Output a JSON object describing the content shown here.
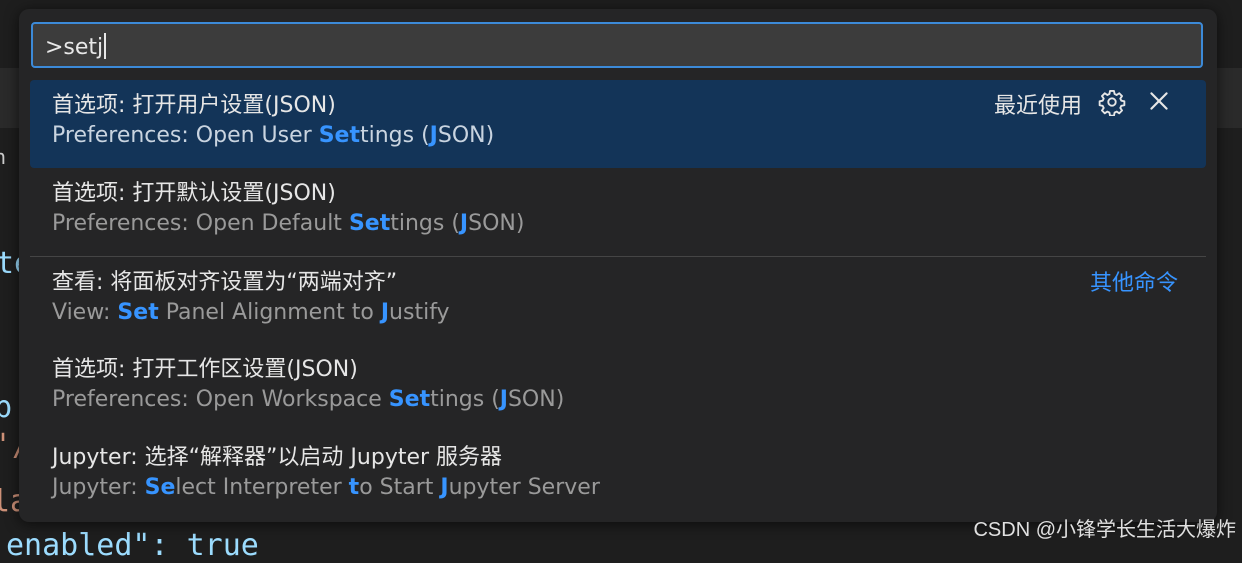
{
  "editor_fragments": [
    "n",
    "te",
    "b",
    "'/",
    "la",
    "enabled\": true"
  ],
  "palette": {
    "input_value": ">setj",
    "items": [
      {
        "label": "首选项: 打开用户设置(JSON)",
        "detail_parts": [
          {
            "t": "Preferences: Open User ",
            "h": false
          },
          {
            "t": "Set",
            "h": true
          },
          {
            "t": "tings (",
            "h": false
          },
          {
            "t": "J",
            "h": true
          },
          {
            "t": "SON)",
            "h": false
          }
        ],
        "selected": true,
        "recently_used": "最近使用"
      },
      {
        "label": "首选项: 打开默认设置(JSON)",
        "detail_parts": [
          {
            "t": "Preferences: Open Default ",
            "h": false
          },
          {
            "t": "Set",
            "h": true
          },
          {
            "t": "tings (",
            "h": false
          },
          {
            "t": "J",
            "h": true
          },
          {
            "t": "SON)",
            "h": false
          }
        ]
      },
      {
        "label": "查看: 将面板对齐设置为“两端对齐”",
        "detail_parts": [
          {
            "t": "View: ",
            "h": false
          },
          {
            "t": "Set",
            "h": true
          },
          {
            "t": " Panel Alignment to ",
            "h": false
          },
          {
            "t": "J",
            "h": true
          },
          {
            "t": "ustify",
            "h": false
          }
        ],
        "group_label": "其他命令"
      },
      {
        "label": "首选项: 打开工作区设置(JSON)",
        "detail_parts": [
          {
            "t": "Preferences: Open Workspace ",
            "h": false
          },
          {
            "t": "Set",
            "h": true
          },
          {
            "t": "tings (",
            "h": false
          },
          {
            "t": "J",
            "h": true
          },
          {
            "t": "SON)",
            "h": false
          }
        ]
      },
      {
        "label": "Jupyter: 选择“解释器”以启动 Jupyter 服务器",
        "detail_parts": [
          {
            "t": "Jupyter: ",
            "h": false
          },
          {
            "t": "Se",
            "h": true
          },
          {
            "t": "lect Interpreter ",
            "h": false
          },
          {
            "t": "t",
            "h": true
          },
          {
            "t": "o Start ",
            "h": false
          },
          {
            "t": "J",
            "h": true
          },
          {
            "t": "upyter Server",
            "h": false
          }
        ]
      }
    ]
  },
  "icons": {
    "gear": "gear-icon",
    "close": "close-icon"
  },
  "colors": {
    "accent": "#3794ff",
    "selected_bg": "#133458",
    "focus_border": "#3c8ad8"
  },
  "watermark": "CSDN @小锋学长生活大爆炸"
}
